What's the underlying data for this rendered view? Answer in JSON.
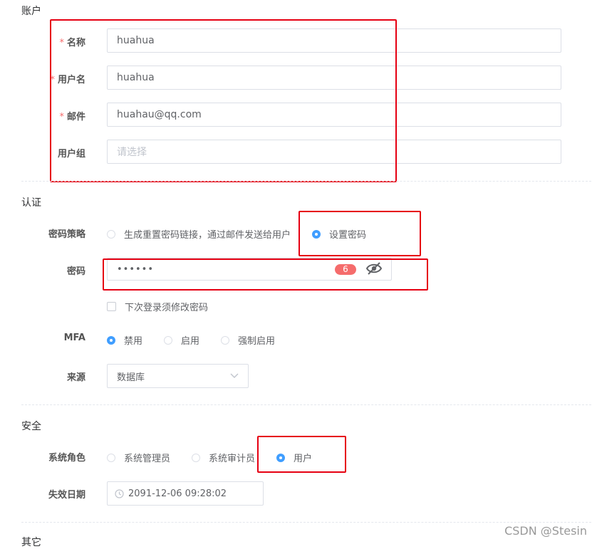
{
  "sections": {
    "account": "账户",
    "auth": "认证",
    "security": "安全",
    "other": "其它"
  },
  "account": {
    "required_mark": "*",
    "name_label": "名称",
    "name_value": "huahua",
    "username_label": "用户名",
    "username_value": "huahua",
    "email_label": "邮件",
    "email_value": "huahau@qq.com",
    "group_label": "用户组",
    "group_placeholder": "请选择"
  },
  "auth": {
    "policy_label": "密码策略",
    "policy_option_link": "生成重置密码链接，通过邮件发送给用户",
    "policy_option_set": "设置密码",
    "policy_selected": "set",
    "password_label": "密码",
    "password_masked": "••••••",
    "password_length": "6",
    "must_change_label": "下次登录须修改密码",
    "mfa_label": "MFA",
    "mfa_options": [
      "禁用",
      "启用",
      "强制启用"
    ],
    "mfa_selected": 0,
    "source_label": "来源",
    "source_value": "数据库"
  },
  "security": {
    "role_label": "系统角色",
    "role_options": [
      "系统管理员",
      "系统审计员",
      "用户"
    ],
    "role_selected": 2,
    "expire_label": "失效日期",
    "expire_value": "2091-12-06 09:28:02"
  },
  "watermark": "CSDN @Stesin",
  "colors": {
    "annotation": "#e60012",
    "accent": "#409eff",
    "required": "#f56c6c"
  }
}
